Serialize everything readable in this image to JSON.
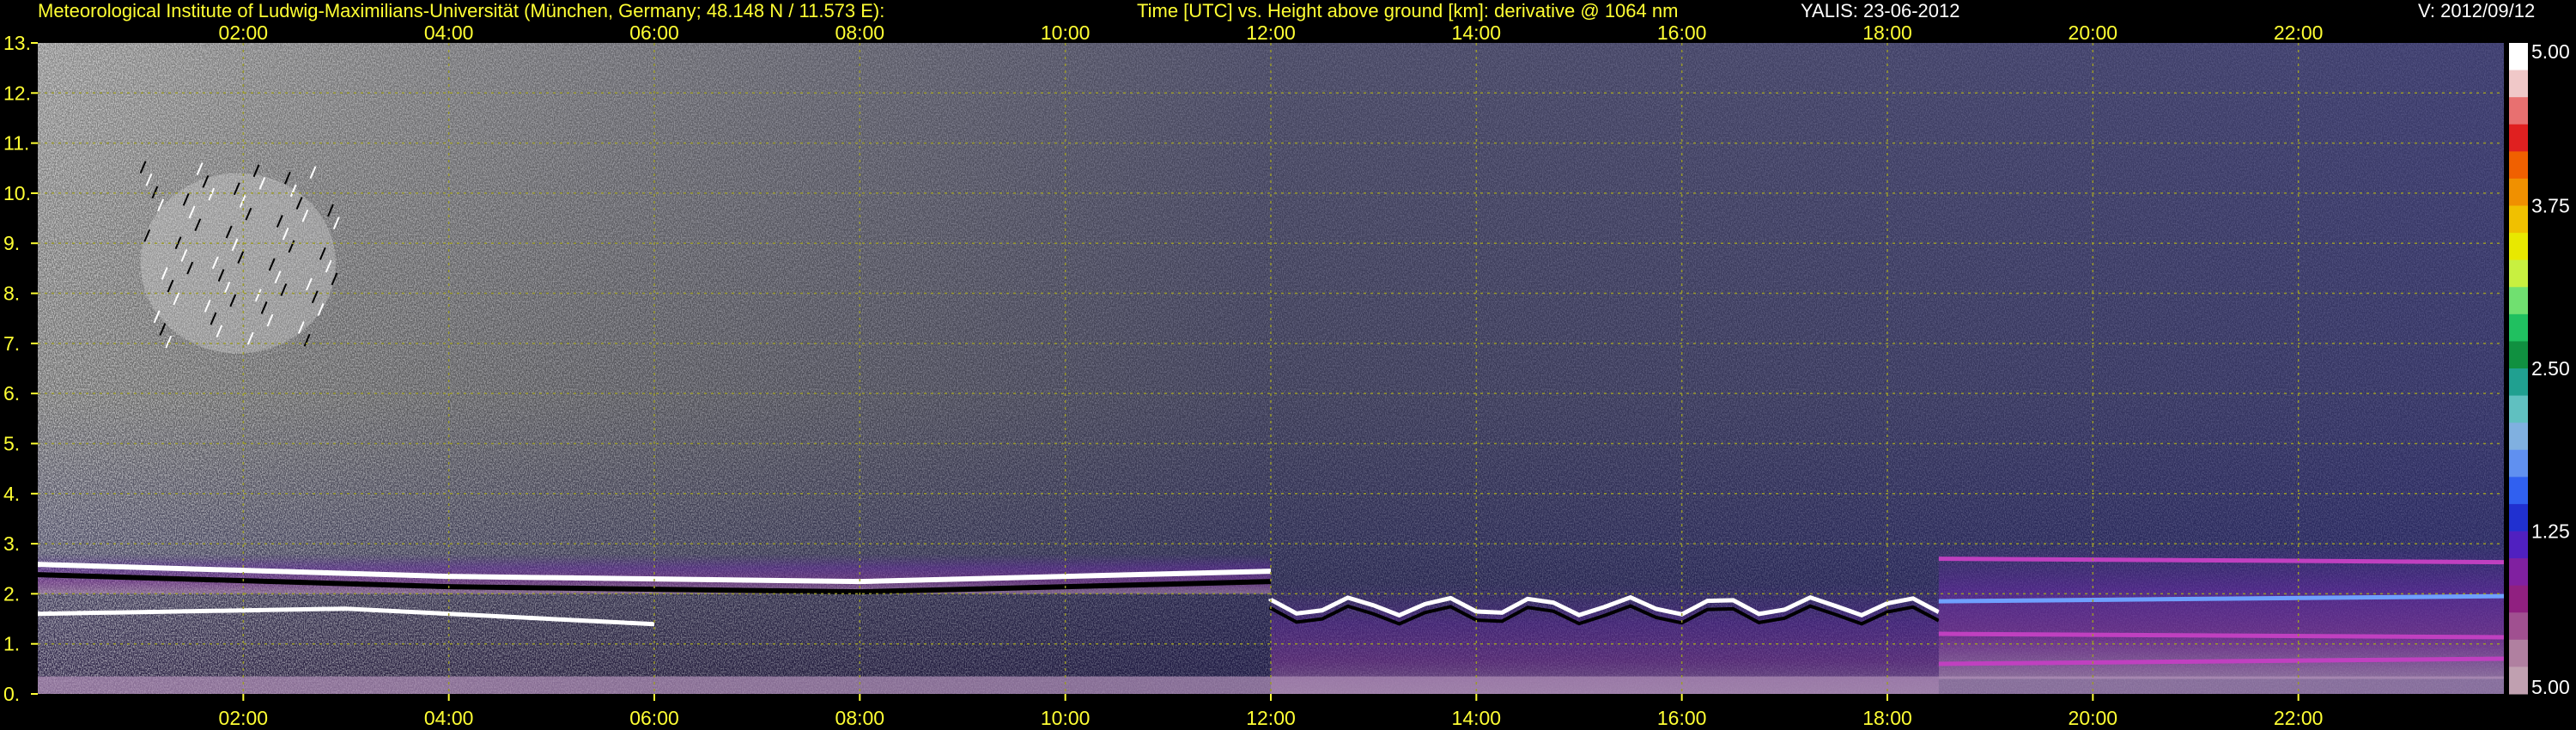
{
  "header": {
    "institute": "Meteorological Institute of Ludwig-Maximilians-Universität (München, Germany; 48.148 N / 11.573 E):",
    "description": "Time [UTC] vs. Height above ground [km]: derivative @ 1064 nm",
    "instrument_date": "YALIS: 23-06-2012",
    "version": "V: 2012/09/12"
  },
  "colors": {
    "text_primary": "#ffff33",
    "text_secondary": "#ffffff",
    "grid": "#9a9a2a",
    "background": "#000000"
  },
  "chart_data": {
    "type": "heatmap",
    "title": "Time [UTC] vs. Height above ground [km]: derivative @ 1064 nm",
    "xlabel": "",
    "ylabel": "",
    "x_ticks": [
      "02:00",
      "04:00",
      "06:00",
      "08:00",
      "10:00",
      "12:00",
      "14:00",
      "16:00",
      "18:00",
      "20:00",
      "22:00"
    ],
    "x_tick_hours": [
      2,
      4,
      6,
      8,
      10,
      12,
      14,
      16,
      18,
      20,
      22
    ],
    "xlim": [
      0,
      24
    ],
    "y_ticks": [
      "0.",
      "1.",
      "2.",
      "3.",
      "4.",
      "5.",
      "6.",
      "7.",
      "8.",
      "9.",
      "10.",
      "11.",
      "12.",
      "13."
    ],
    "ylim": [
      0,
      13
    ],
    "grid": true,
    "colorbar": {
      "labels": [
        "5.00",
        "3.75",
        "2.50",
        "1.25",
        "5.00"
      ],
      "label_fractions": [
        0,
        0.25,
        0.5,
        0.75,
        1
      ],
      "colors": [
        "#ffffff",
        "#f0c8c8",
        "#e87070",
        "#e02020",
        "#f06000",
        "#f09000",
        "#f0c000",
        "#e8e800",
        "#c8f040",
        "#70e070",
        "#20c060",
        "#109040",
        "#20a090",
        "#60c0c0",
        "#80b0e0",
        "#6090f0",
        "#3060f0",
        "#2030d0",
        "#5020c0",
        "#8020a0",
        "#902080",
        "#a05090",
        "#b080a0",
        "#c0a0b0"
      ]
    },
    "features": [
      {
        "name": "upper cloud patch",
        "x": [
          1.0,
          2.9
        ],
        "y": [
          6.8,
          10.4
        ]
      },
      {
        "name": "residual layer",
        "x": [
          0.0,
          12.0
        ],
        "y": [
          2.0,
          2.8
        ]
      },
      {
        "name": "boundary layer top",
        "x": [
          12.0,
          18.5
        ],
        "y": [
          1.3,
          2.2
        ]
      },
      {
        "name": "stable night layers",
        "x": [
          18.5,
          24.0
        ],
        "y": [
          0.3,
          3.0
        ]
      }
    ]
  }
}
